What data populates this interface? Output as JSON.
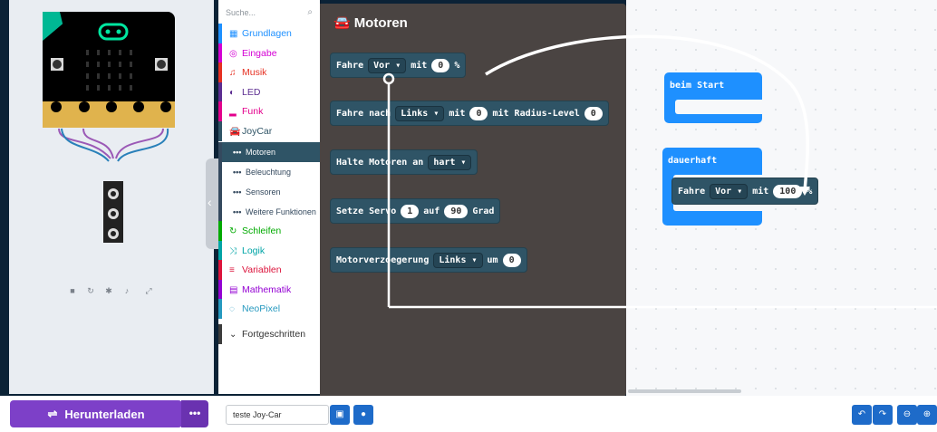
{
  "toolbox": {
    "search_placeholder": "Suche...",
    "search_icon": "magnifier-icon",
    "categories": [
      {
        "label": "Grundlagen",
        "color": "#1e90ff",
        "icon": "grid-icon"
      },
      {
        "label": "Eingabe",
        "color": "#d400d4",
        "icon": "target-icon"
      },
      {
        "label": "Musik",
        "color": "#e63022",
        "icon": "headphones-icon"
      },
      {
        "label": "LED",
        "color": "#5c2d91",
        "icon": "toggle-icon"
      },
      {
        "label": "Funk",
        "color": "#e3008c",
        "icon": "signal-bars-icon"
      },
      {
        "label": "JoyCar",
        "color": "#2f5466",
        "icon": "car-icon"
      }
    ],
    "subcategories": [
      {
        "label": "Motoren",
        "selected": true
      },
      {
        "label": "Beleuchtung",
        "selected": false
      },
      {
        "label": "Sensoren",
        "selected": false
      },
      {
        "label": "Weitere Funktionen",
        "selected": false
      }
    ],
    "categories2": [
      {
        "label": "Schleifen",
        "color": "#00aa00",
        "icon": "refresh-icon"
      },
      {
        "label": "Logik",
        "color": "#00a4a6",
        "icon": "shuffle-icon"
      },
      {
        "label": "Variablen",
        "color": "#dc143c",
        "icon": "list-icon"
      },
      {
        "label": "Mathematik",
        "color": "#9400d3",
        "icon": "calculator-icon"
      },
      {
        "label": "NeoPixel",
        "color": "#2699bf",
        "icon": "dotted-circle-icon"
      }
    ],
    "advanced": {
      "label": "Fortgeschritten",
      "icon": "chevron-down-icon"
    }
  },
  "flyout": {
    "title": "Motoren",
    "blocks": [
      {
        "pre": "Fahre",
        "dropdown": "Vor ▾",
        "mid": "mit",
        "num": "0",
        "post": "%"
      },
      {
        "pre": "Fahre nach",
        "dropdown": "Links ▾",
        "mid": "mit",
        "num": "0",
        "mid2": "mit Radius-Level",
        "num2": "0"
      },
      {
        "pre": "Halte Motoren an",
        "dropdown": "hart ▾"
      },
      {
        "pre": "Setze Servo",
        "num": "1",
        "mid": "auf",
        "num2": "90",
        "post": "Grad"
      },
      {
        "pre": "Motorverzoegerung",
        "dropdown": "Links ▾",
        "mid": "um",
        "num": "0"
      }
    ]
  },
  "workspace": {
    "start_label": "beim Start",
    "forever_label": "dauerhaft",
    "drive_block": {
      "pre": "Fahre",
      "dropdown": "Vor ▾",
      "mid": "mit",
      "num": "100",
      "post": "%"
    }
  },
  "simulator": {
    "controls": [
      "stop-icon",
      "restart-icon",
      "debug-icon",
      "mute-icon",
      "fullscreen-icon"
    ]
  },
  "bottom": {
    "download_label": "Herunterladen",
    "download_icon": "usb-icon",
    "more_label": "•••",
    "project_name": "teste Joy-Car",
    "save_icon": "save-icon",
    "github_icon": "github-icon",
    "undo_icon": "undo-icon",
    "redo_icon": "redo-icon",
    "zoom_out_icon": "zoom-out-icon",
    "zoom_in_icon": "zoom-in-icon"
  }
}
